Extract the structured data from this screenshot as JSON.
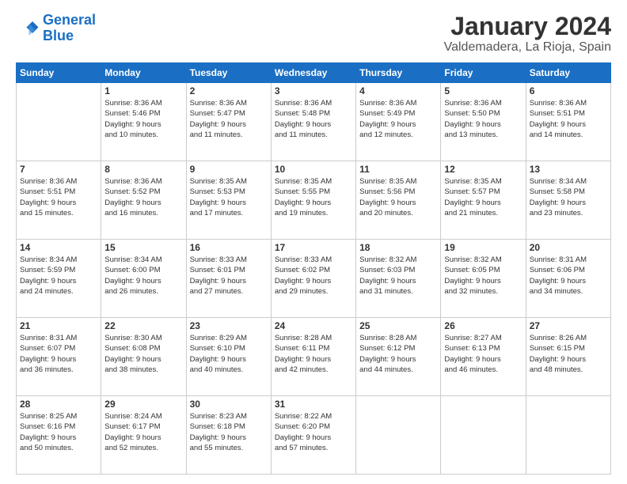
{
  "logo": {
    "line1": "General",
    "line2": "Blue"
  },
  "title": "January 2024",
  "subtitle": "Valdemadera, La Rioja, Spain",
  "days_of_week": [
    "Sunday",
    "Monday",
    "Tuesday",
    "Wednesday",
    "Thursday",
    "Friday",
    "Saturday"
  ],
  "weeks": [
    [
      {
        "day": "",
        "info": ""
      },
      {
        "day": "1",
        "info": "Sunrise: 8:36 AM\nSunset: 5:46 PM\nDaylight: 9 hours\nand 10 minutes."
      },
      {
        "day": "2",
        "info": "Sunrise: 8:36 AM\nSunset: 5:47 PM\nDaylight: 9 hours\nand 11 minutes."
      },
      {
        "day": "3",
        "info": "Sunrise: 8:36 AM\nSunset: 5:48 PM\nDaylight: 9 hours\nand 11 minutes."
      },
      {
        "day": "4",
        "info": "Sunrise: 8:36 AM\nSunset: 5:49 PM\nDaylight: 9 hours\nand 12 minutes."
      },
      {
        "day": "5",
        "info": "Sunrise: 8:36 AM\nSunset: 5:50 PM\nDaylight: 9 hours\nand 13 minutes."
      },
      {
        "day": "6",
        "info": "Sunrise: 8:36 AM\nSunset: 5:51 PM\nDaylight: 9 hours\nand 14 minutes."
      }
    ],
    [
      {
        "day": "7",
        "info": "Sunrise: 8:36 AM\nSunset: 5:51 PM\nDaylight: 9 hours\nand 15 minutes."
      },
      {
        "day": "8",
        "info": "Sunrise: 8:36 AM\nSunset: 5:52 PM\nDaylight: 9 hours\nand 16 minutes."
      },
      {
        "day": "9",
        "info": "Sunrise: 8:35 AM\nSunset: 5:53 PM\nDaylight: 9 hours\nand 17 minutes."
      },
      {
        "day": "10",
        "info": "Sunrise: 8:35 AM\nSunset: 5:55 PM\nDaylight: 9 hours\nand 19 minutes."
      },
      {
        "day": "11",
        "info": "Sunrise: 8:35 AM\nSunset: 5:56 PM\nDaylight: 9 hours\nand 20 minutes."
      },
      {
        "day": "12",
        "info": "Sunrise: 8:35 AM\nSunset: 5:57 PM\nDaylight: 9 hours\nand 21 minutes."
      },
      {
        "day": "13",
        "info": "Sunrise: 8:34 AM\nSunset: 5:58 PM\nDaylight: 9 hours\nand 23 minutes."
      }
    ],
    [
      {
        "day": "14",
        "info": "Sunrise: 8:34 AM\nSunset: 5:59 PM\nDaylight: 9 hours\nand 24 minutes."
      },
      {
        "day": "15",
        "info": "Sunrise: 8:34 AM\nSunset: 6:00 PM\nDaylight: 9 hours\nand 26 minutes."
      },
      {
        "day": "16",
        "info": "Sunrise: 8:33 AM\nSunset: 6:01 PM\nDaylight: 9 hours\nand 27 minutes."
      },
      {
        "day": "17",
        "info": "Sunrise: 8:33 AM\nSunset: 6:02 PM\nDaylight: 9 hours\nand 29 minutes."
      },
      {
        "day": "18",
        "info": "Sunrise: 8:32 AM\nSunset: 6:03 PM\nDaylight: 9 hours\nand 31 minutes."
      },
      {
        "day": "19",
        "info": "Sunrise: 8:32 AM\nSunset: 6:05 PM\nDaylight: 9 hours\nand 32 minutes."
      },
      {
        "day": "20",
        "info": "Sunrise: 8:31 AM\nSunset: 6:06 PM\nDaylight: 9 hours\nand 34 minutes."
      }
    ],
    [
      {
        "day": "21",
        "info": "Sunrise: 8:31 AM\nSunset: 6:07 PM\nDaylight: 9 hours\nand 36 minutes."
      },
      {
        "day": "22",
        "info": "Sunrise: 8:30 AM\nSunset: 6:08 PM\nDaylight: 9 hours\nand 38 minutes."
      },
      {
        "day": "23",
        "info": "Sunrise: 8:29 AM\nSunset: 6:10 PM\nDaylight: 9 hours\nand 40 minutes."
      },
      {
        "day": "24",
        "info": "Sunrise: 8:28 AM\nSunset: 6:11 PM\nDaylight: 9 hours\nand 42 minutes."
      },
      {
        "day": "25",
        "info": "Sunrise: 8:28 AM\nSunset: 6:12 PM\nDaylight: 9 hours\nand 44 minutes."
      },
      {
        "day": "26",
        "info": "Sunrise: 8:27 AM\nSunset: 6:13 PM\nDaylight: 9 hours\nand 46 minutes."
      },
      {
        "day": "27",
        "info": "Sunrise: 8:26 AM\nSunset: 6:15 PM\nDaylight: 9 hours\nand 48 minutes."
      }
    ],
    [
      {
        "day": "28",
        "info": "Sunrise: 8:25 AM\nSunset: 6:16 PM\nDaylight: 9 hours\nand 50 minutes."
      },
      {
        "day": "29",
        "info": "Sunrise: 8:24 AM\nSunset: 6:17 PM\nDaylight: 9 hours\nand 52 minutes."
      },
      {
        "day": "30",
        "info": "Sunrise: 8:23 AM\nSunset: 6:18 PM\nDaylight: 9 hours\nand 55 minutes."
      },
      {
        "day": "31",
        "info": "Sunrise: 8:22 AM\nSunset: 6:20 PM\nDaylight: 9 hours\nand 57 minutes."
      },
      {
        "day": "",
        "info": ""
      },
      {
        "day": "",
        "info": ""
      },
      {
        "day": "",
        "info": ""
      }
    ]
  ]
}
